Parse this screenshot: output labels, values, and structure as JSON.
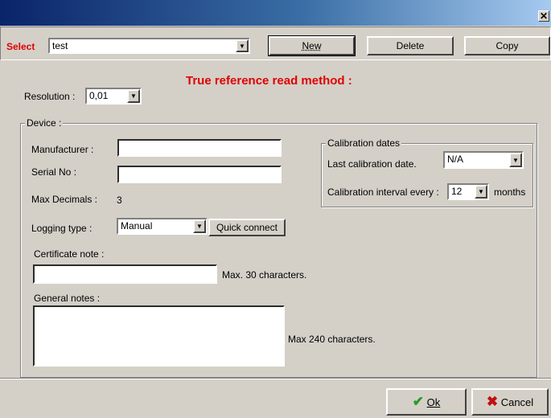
{
  "window": {
    "close_glyph": "✕"
  },
  "toolbar": {
    "select_label": "Select",
    "select_value": "test",
    "new_label": "New",
    "delete_label": "Delete",
    "copy_label": "Copy"
  },
  "form": {
    "heading": "True reference read method :",
    "resolution_label": "Resolution :",
    "resolution_value": "0,01",
    "device_legend": "Device :",
    "manufacturer_label": "Manufacturer :",
    "manufacturer_value": "",
    "serial_label": "Serial No :",
    "serial_value": "",
    "max_decimals_label": "Max Decimals :",
    "max_decimals_value": "3",
    "logging_label": "Logging type :",
    "logging_value": "Manual",
    "quick_connect_label": "Quick connect",
    "calibration": {
      "legend": "Calibration dates",
      "last_label": "Last calibration date.",
      "last_value": "N/A",
      "interval_label": "Calibration interval every :",
      "interval_value": "12",
      "interval_unit": "months"
    },
    "certificate_label": "Certificate note :",
    "certificate_value": "",
    "certificate_hint": "Max. 30 characters.",
    "notes_label": "General notes :",
    "notes_value": "",
    "notes_hint": "Max 240 characters."
  },
  "footer": {
    "ok_label": "Ok",
    "cancel_label": "Cancel"
  },
  "colors": {
    "accent_red": "#e00000",
    "ok_green": "#2a9a2a",
    "cancel_red": "#c01010",
    "titlebar": "#0a246a"
  }
}
